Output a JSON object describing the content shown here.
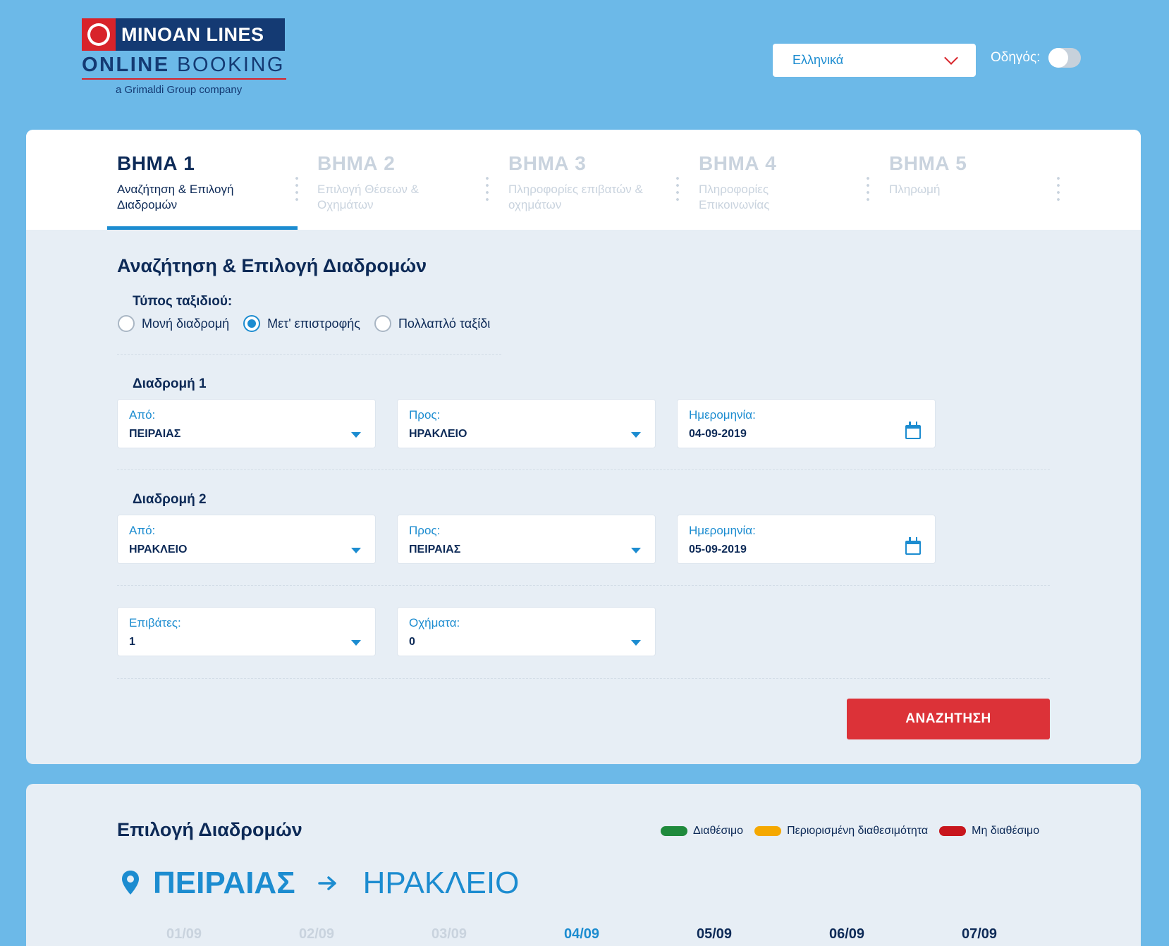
{
  "header": {
    "logo": {
      "brand": "MINOAN LINES",
      "sub_bold": "ONLINE",
      "sub_light": " BOOKING",
      "tagline": "a Grimaldi Group company"
    },
    "language": "Ελληνικά",
    "guide_label": "Οδηγός:"
  },
  "steps": [
    {
      "title": "ΒΗΜΑ 1",
      "desc": "Αναζήτηση & Επιλογή Διαδρομών"
    },
    {
      "title": "ΒΗΜΑ 2",
      "desc": "Επιλογή Θέσεων & Οχημάτων"
    },
    {
      "title": "ΒΗΜΑ 3",
      "desc": "Πληροφορίες επιβατών & οχημάτων"
    },
    {
      "title": "ΒΗΜΑ 4",
      "desc": "Πληροφορίες Επικοινωνίας"
    },
    {
      "title": "ΒΗΜΑ 5",
      "desc": "Πληρωμή"
    }
  ],
  "search": {
    "title": "Αναζήτηση & Επιλογή Διαδρομών",
    "trip_type_label": "Τύπος ταξιδιού:",
    "trip_types": [
      "Μονή διαδρομή",
      "Μετ' επιστροφής",
      "Πολλαπλό ταξίδι"
    ],
    "selected_trip_type": "Μετ' επιστροφής",
    "route1": {
      "label": "Διαδρομή 1",
      "from_label": "Από:",
      "from": "ΠΕΙΡΑΙΑΣ",
      "to_label": "Προς:",
      "to": "ΗΡΑΚΛΕΙΟ",
      "date_label": "Ημερομηνία:",
      "date": "04-09-2019"
    },
    "route2": {
      "label": "Διαδρομή 2",
      "from_label": "Από:",
      "from": "ΗΡΑΚΛΕΙΟ",
      "to_label": "Προς:",
      "to": "ΠΕΙΡΑΙΑΣ",
      "date_label": "Ημερομηνία:",
      "date": "05-09-2019"
    },
    "passengers_label": "Επιβάτες:",
    "passengers": "1",
    "vehicles_label": "Οχήματα:",
    "vehicles": "0",
    "button": "ΑΝΑΖΗΤΗΣΗ"
  },
  "selection": {
    "title": "Επιλογή Διαδρομών",
    "legend": [
      {
        "label": "Διαθέσιμο",
        "color": "#1f8a3c"
      },
      {
        "label": "Περιορισμένη διαθεσιμότητα",
        "color": "#f5a800"
      },
      {
        "label": "Μη διαθέσιμο",
        "color": "#c8161d"
      }
    ],
    "from": "ΠΕΙΡΑΙΑΣ",
    "to": "ΗΡΑΚΛΕΙΟ",
    "dates": [
      "01/09",
      "02/09",
      "03/09",
      "04/09",
      "05/09",
      "06/09",
      "07/09"
    ],
    "selected_date": "04/09"
  },
  "colors": {
    "accent": "#1c8cd0",
    "brand_red": "#dc3238",
    "navy": "#0d2a57",
    "background": "#6cb9e8"
  }
}
